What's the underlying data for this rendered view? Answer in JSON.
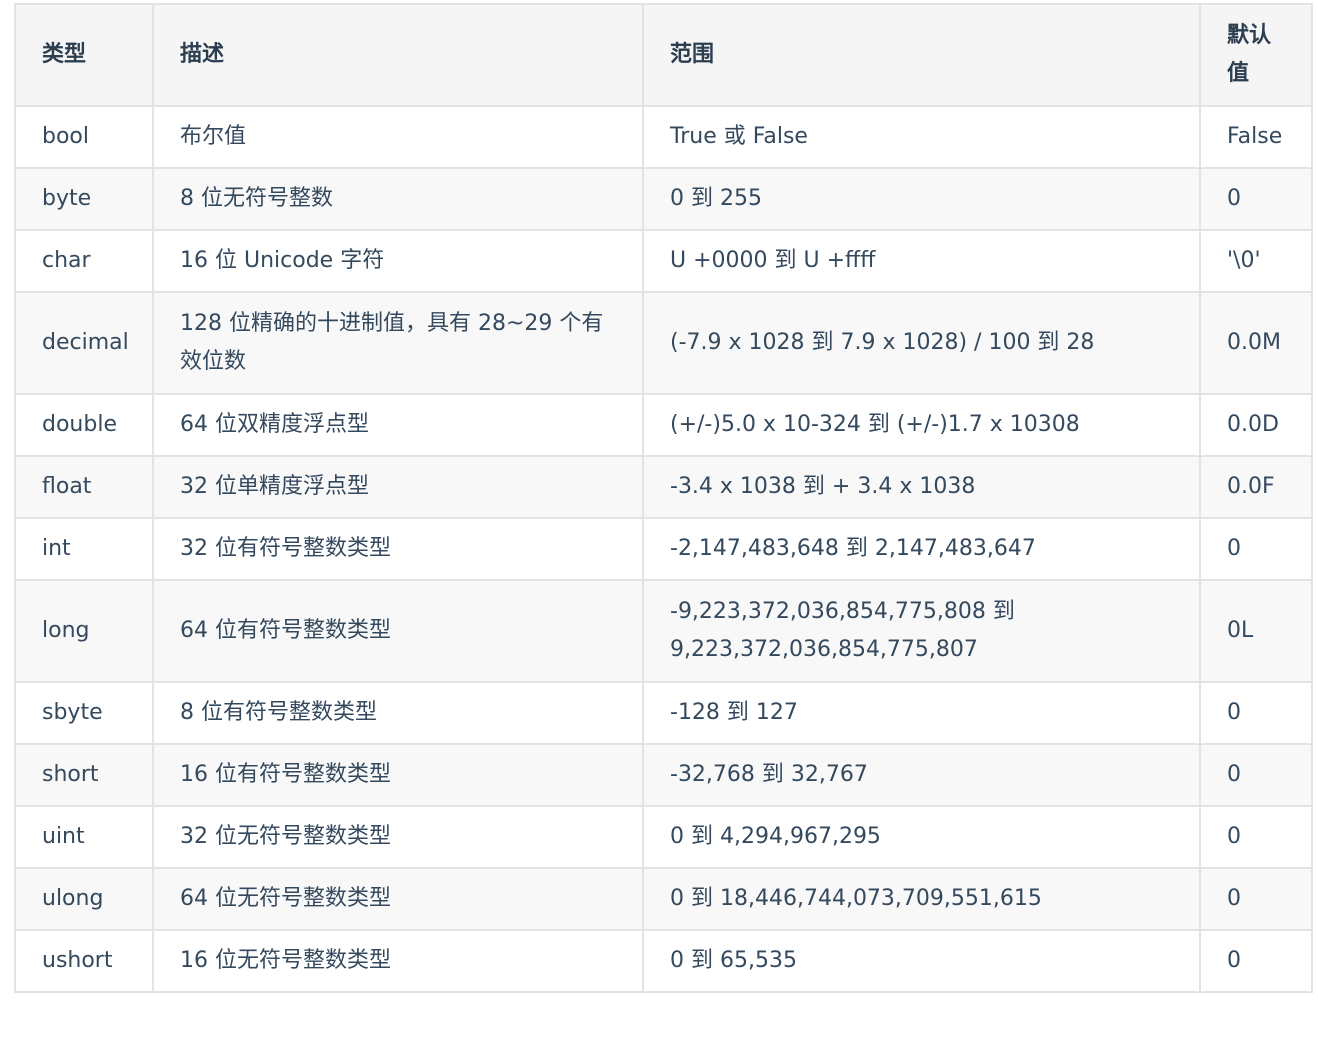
{
  "table": {
    "headers": [
      "类型",
      "描述",
      "范围",
      "默认值"
    ],
    "rows": [
      {
        "type": "bool",
        "desc": "布尔值",
        "range": "True 或 False",
        "default": "False"
      },
      {
        "type": "byte",
        "desc": "8 位无符号整数",
        "range": "0 到 255",
        "default": "0"
      },
      {
        "type": "char",
        "desc": "16 位 Unicode 字符",
        "range": "U +0000 到 U +ffff",
        "default": "'\\0'"
      },
      {
        "type": "decimal",
        "desc": "128 位精确的十进制值，具有 28~29 个有效位数",
        "range": "(-7.9 x 1028 到 7.9 x 1028) / 100 到 28",
        "default": "0.0M"
      },
      {
        "type": "double",
        "desc": "64 位双精度浮点型",
        "range": "(+/-)5.0 x 10-324 到 (+/-)1.7 x 10308",
        "default": "0.0D"
      },
      {
        "type": "float",
        "desc": "32 位单精度浮点型",
        "range": "-3.4 x 1038 到 + 3.4 x 1038",
        "default": "0.0F"
      },
      {
        "type": "int",
        "desc": "32 位有符号整数类型",
        "range": "-2,147,483,648 到 2,147,483,647",
        "default": "0"
      },
      {
        "type": "long",
        "desc": "64 位有符号整数类型",
        "range": "-9,223,372,036,854,775,808 到 9,223,372,036,854,775,807",
        "default": "0L"
      },
      {
        "type": "sbyte",
        "desc": "8 位有符号整数类型",
        "range": "-128 到 127",
        "default": "0"
      },
      {
        "type": "short",
        "desc": "16 位有符号整数类型",
        "range": "-32,768 到 32,767",
        "default": "0"
      },
      {
        "type": "uint",
        "desc": "32 位无符号整数类型",
        "range": "0 到 4,294,967,295",
        "default": "0"
      },
      {
        "type": "ulong",
        "desc": "64 位无符号整数类型",
        "range": "0 到 18,446,744,073,709,551,615",
        "default": "0"
      },
      {
        "type": "ushort",
        "desc": "16 位无符号整数类型",
        "range": "0 到 65,535",
        "default": "0"
      }
    ]
  }
}
